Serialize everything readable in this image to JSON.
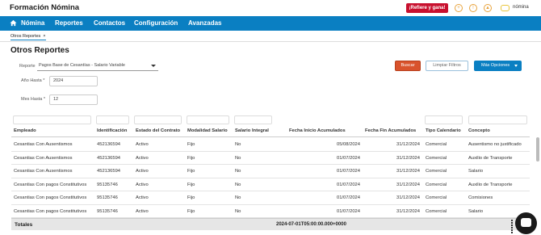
{
  "header": {
    "app_title": "Formación Nómina",
    "refer_button": "¡Refiere y gana!",
    "user_name": "nómina"
  },
  "nav": {
    "items": [
      "Nómina",
      "Reportes",
      "Contactos",
      "Configuración",
      "Avanzadas"
    ]
  },
  "tabs": [
    {
      "label": "Otros Reportes",
      "close": "×"
    }
  ],
  "page": {
    "title": "Otros Reportes",
    "report_label": "Reporte",
    "report_value": "Pagos Base de Cesantías - Salario Variable",
    "year_label": "Año Hasta *",
    "year_value": "2024",
    "month_label": "Mes Hasta *",
    "month_value": "12"
  },
  "actions": {
    "search": "Buscar",
    "clear": "Limpiar Filtros",
    "more": "Más Opciones"
  },
  "table": {
    "columns": [
      "Empleado",
      "Identificación",
      "Estado del Contrato",
      "Modalidad Salario",
      "Salario Integral",
      "Fecha Inicio Acumulados",
      "Fecha Fin Acumulados",
      "Tipo Calendario",
      "Concepto"
    ],
    "rows": [
      [
        "Cesantias Con Ausentismos",
        "452136594",
        "Activo",
        "Fijo",
        "No",
        "05/08/2024",
        "31/12/2024",
        "Comercial",
        "Ausentismo no justificado"
      ],
      [
        "Cesantias Con Ausentismos",
        "452136594",
        "Activo",
        "Fijo",
        "No",
        "01/07/2024",
        "31/12/2024",
        "Comercial",
        "Auxilio de Transporte"
      ],
      [
        "Cesantias Con Ausentismos",
        "452136594",
        "Activo",
        "Fijo",
        "No",
        "01/07/2024",
        "31/12/2024",
        "Comercial",
        "Salario"
      ],
      [
        "Cesantias Con pagos Constitutivos",
        "95135746",
        "Activo",
        "Fijo",
        "No",
        "01/07/2024",
        "31/12/2024",
        "Comercial",
        "Auxilio de Transporte"
      ],
      [
        "Cesantias Con pagos Constitutivos",
        "95135746",
        "Activo",
        "Fijo",
        "No",
        "01/07/2024",
        "31/12/2024",
        "Comercial",
        "Comisiones"
      ],
      [
        "Cesantias Con pagos Constitutivos",
        "95135746",
        "Activo",
        "Fijo",
        "No",
        "01/07/2024",
        "31/12/2024",
        "Comercial",
        "Salario"
      ]
    ],
    "totals_label": "Totales",
    "totals_date": "2024-07-01T05:00:00.000+0000"
  },
  "colors": {
    "nav_bg": "#0a7fc2",
    "refer_bg": "#c8102e",
    "search_bg": "#d9532c"
  }
}
